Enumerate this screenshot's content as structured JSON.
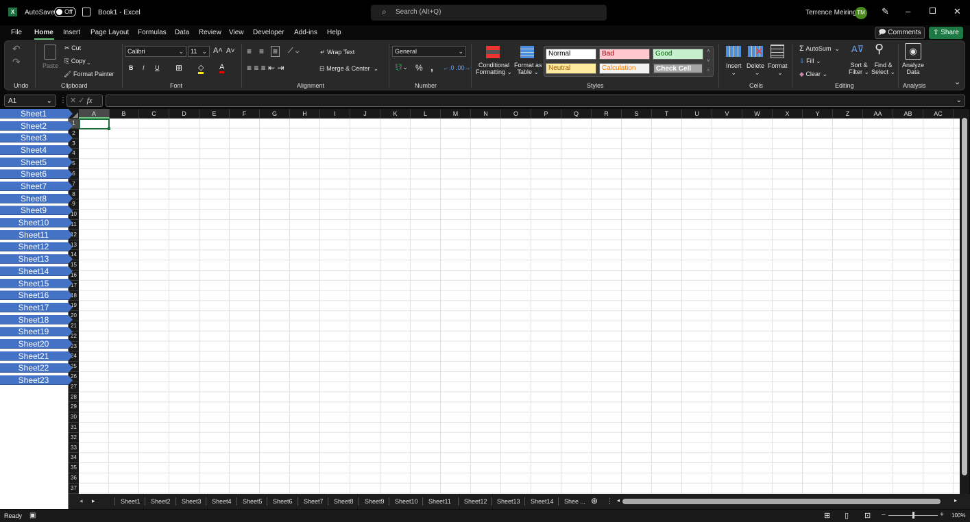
{
  "titlebar": {
    "autosave_label": "AutoSave",
    "autosave_state": "Off",
    "doc_title": "Book1  -  Excel",
    "search_placeholder": "Search (Alt+Q)",
    "user_name": "Terrence Meiring",
    "user_initials": "TM"
  },
  "menu": {
    "tabs": [
      "File",
      "Home",
      "Insert",
      "Page Layout",
      "Formulas",
      "Data",
      "Review",
      "View",
      "Developer",
      "Add-ins",
      "Help"
    ],
    "active": "Home",
    "comments": "Comments",
    "share": "Share"
  },
  "ribbon": {
    "groups": [
      "Undo",
      "Clipboard",
      "Font",
      "Alignment",
      "Number",
      "Styles",
      "Cells",
      "Editing",
      "Analysis"
    ],
    "clipboard": {
      "paste": "Paste",
      "cut": "Cut",
      "copy": "Copy",
      "format_painter": "Format Painter"
    },
    "font": {
      "name": "Calibri",
      "size": "11",
      "bold": "B",
      "italic": "I",
      "underline": "U"
    },
    "alignment": {
      "wrap": "Wrap Text",
      "merge": "Merge & Center"
    },
    "number": {
      "format": "General",
      "percent": "%",
      "comma": ","
    },
    "styles": {
      "conditional": [
        "Conditional",
        "Formatting"
      ],
      "format_table": [
        "Format as",
        "Table"
      ],
      "cells": [
        {
          "label": "Normal",
          "bg": "#ffffff",
          "fg": "#000000"
        },
        {
          "label": "Bad",
          "bg": "#ffc7ce",
          "fg": "#9c0006"
        },
        {
          "label": "Good",
          "bg": "#c6efce",
          "fg": "#006100"
        },
        {
          "label": "Neutral",
          "bg": "#ffeb9c",
          "fg": "#9c5700"
        },
        {
          "label": "Calculation",
          "bg": "#f2f2f2",
          "fg": "#fa7d00"
        },
        {
          "label": "Check Cell",
          "bg": "#a5a5a5",
          "fg": "#ffffff"
        }
      ]
    },
    "cells": {
      "insert": "Insert",
      "delete": "Delete",
      "format": "Format"
    },
    "editing": {
      "autosum": "AutoSum",
      "fill": "Fill",
      "clear": "Clear",
      "sort": [
        "Sort &",
        "Filter"
      ],
      "find": [
        "Find &",
        "Select"
      ]
    },
    "analysis": {
      "analyze": [
        "Analyze",
        "Data"
      ]
    }
  },
  "formula_bar": {
    "name_box": "A1",
    "fx": "fx",
    "value": ""
  },
  "grid": {
    "columns": [
      "A",
      "B",
      "C",
      "D",
      "E",
      "F",
      "G",
      "H",
      "I",
      "J",
      "K",
      "L",
      "M",
      "N",
      "O",
      "P",
      "Q",
      "R",
      "S",
      "T",
      "U",
      "V",
      "W",
      "X",
      "Y",
      "Z",
      "AA",
      "AB",
      "AC"
    ],
    "rows": [
      "1",
      "2",
      "3",
      "4",
      "5",
      "6",
      "7",
      "8",
      "9",
      "10",
      "11",
      "12",
      "13",
      "14",
      "15",
      "16",
      "17",
      "18",
      "19",
      "20",
      "21",
      "22",
      "23",
      "24",
      "25",
      "26",
      "27",
      "28",
      "29",
      "30",
      "31",
      "32",
      "33",
      "34",
      "35",
      "36",
      "37"
    ],
    "selected": "A1"
  },
  "sheet_list": [
    "Sheet1",
    "Sheet2",
    "Sheet3",
    "Sheet4",
    "Sheet5",
    "Sheet6",
    "Sheet7",
    "Sheet8",
    "Sheet9",
    "Sheet10",
    "Sheet11",
    "Sheet12",
    "Sheet13",
    "Sheet14",
    "Sheet15",
    "Sheet16",
    "Sheet17",
    "Sheet18",
    "Sheet19",
    "Sheet20",
    "Sheet21",
    "Sheet22",
    "Sheet23"
  ],
  "sheet_tabs": [
    "Sheet1",
    "Sheet2",
    "Sheet3",
    "Sheet4",
    "Sheet5",
    "Sheet6",
    "Sheet7",
    "Sheet8",
    "Sheet9",
    "Sheet10",
    "Sheet11",
    "Sheet12",
    "Sheet13",
    "Sheet14",
    "Shee ..."
  ],
  "status": {
    "ready": "Ready",
    "zoom": "100%"
  },
  "colors": {
    "sheet_button": "#4472c4",
    "share": "#1d7a45",
    "selection": "#1e6b3c"
  }
}
